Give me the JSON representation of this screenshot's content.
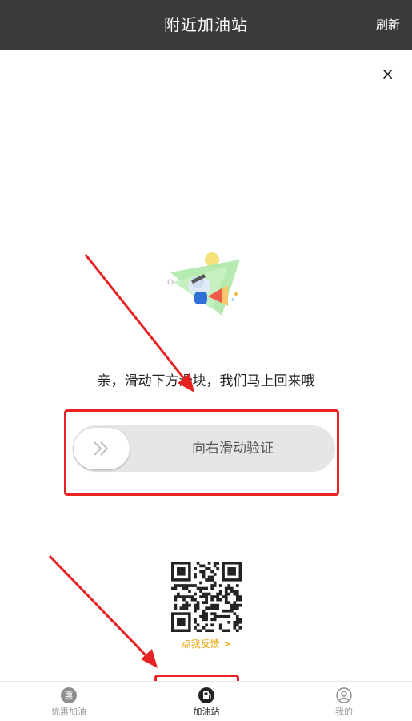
{
  "header": {
    "title": "附近加油站",
    "refresh_label": "刷新"
  },
  "close_label": "×",
  "verification": {
    "prompt": "亲，滑动下方滑块，我们马上回来哦",
    "slider_label": "向右滑动验证"
  },
  "feedback": {
    "link_label": "点我反馈 >"
  },
  "tabbar": {
    "tabs": [
      {
        "label": "优惠加油",
        "icon": "discount-icon",
        "badge_char": "惠",
        "active": false
      },
      {
        "label": "加油站",
        "icon": "gas-station-icon",
        "active": true
      },
      {
        "label": "我的",
        "icon": "user-icon",
        "active": false
      }
    ]
  },
  "annotation_color": "#e62222",
  "accent_color": "#e8a200"
}
